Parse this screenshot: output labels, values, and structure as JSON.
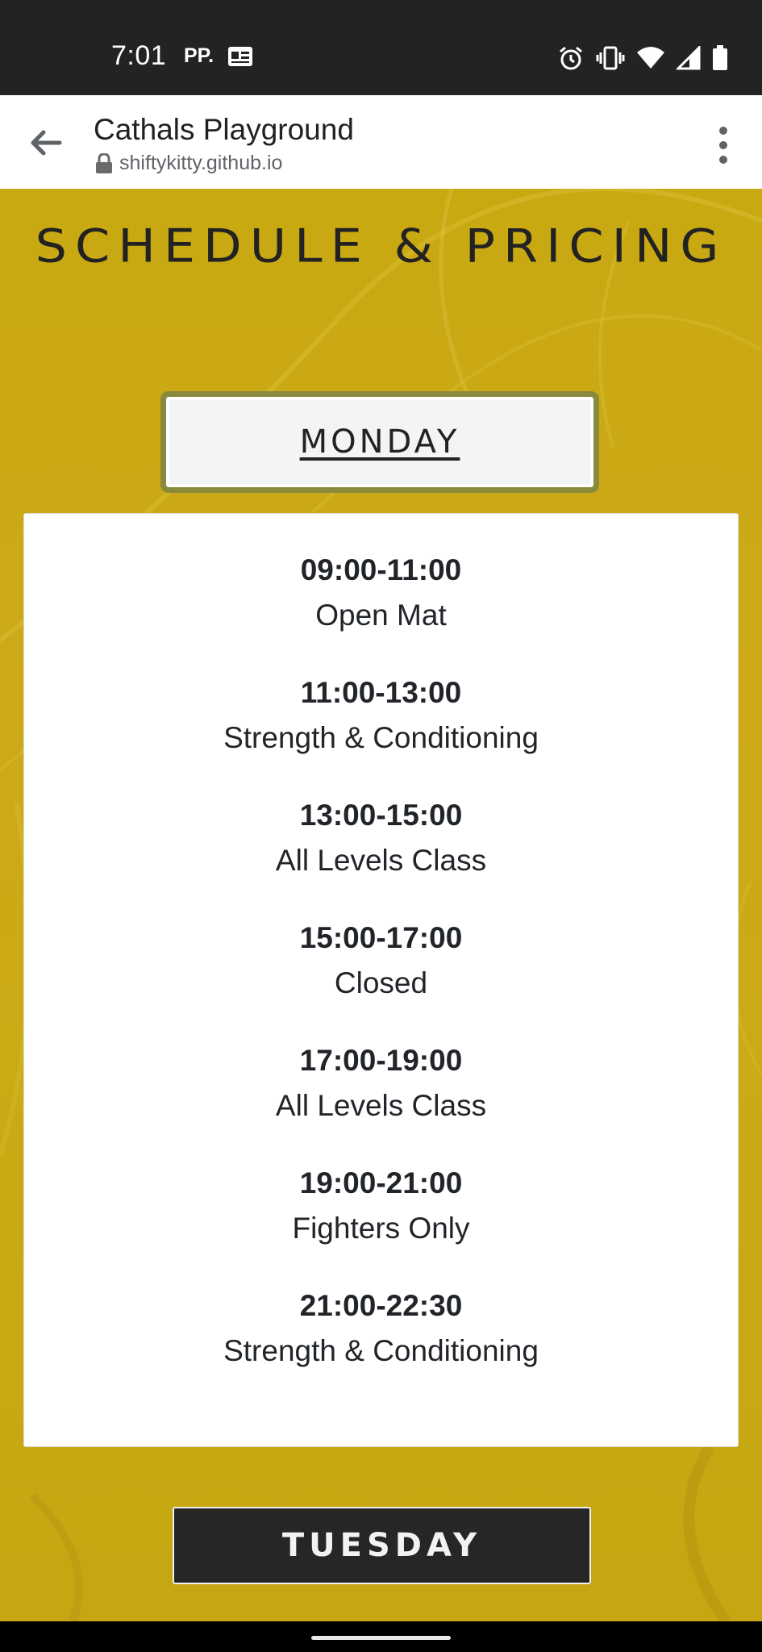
{
  "status_bar": {
    "time": "7:01",
    "carrier": "PP.",
    "icons": [
      "message-icon",
      "alarm-icon",
      "vibrate-icon",
      "wifi-icon",
      "signal-icon",
      "battery-icon"
    ]
  },
  "browser": {
    "page_title": "Cathals Playground",
    "url": "shiftykitty.github.io",
    "icons": [
      "back-arrow-icon",
      "lock-icon",
      "more-vert-icon"
    ]
  },
  "page": {
    "heading": "SCHEDULE & PRICING",
    "active_day": "MONDAY",
    "next_day": "TUESDAY",
    "accent_color": "#c9aa14",
    "slots": [
      {
        "time": "09:00-11:00",
        "class": "Open Mat"
      },
      {
        "time": "11:00-13:00",
        "class": "Strength & Conditioning"
      },
      {
        "time": "13:00-15:00",
        "class": "All Levels Class"
      },
      {
        "time": "15:00-17:00",
        "class": "Closed"
      },
      {
        "time": "17:00-19:00",
        "class": "All Levels Class"
      },
      {
        "time": "19:00-21:00",
        "class": "Fighters Only"
      },
      {
        "time": "21:00-22:30",
        "class": "Strength & Conditioning"
      }
    ]
  }
}
